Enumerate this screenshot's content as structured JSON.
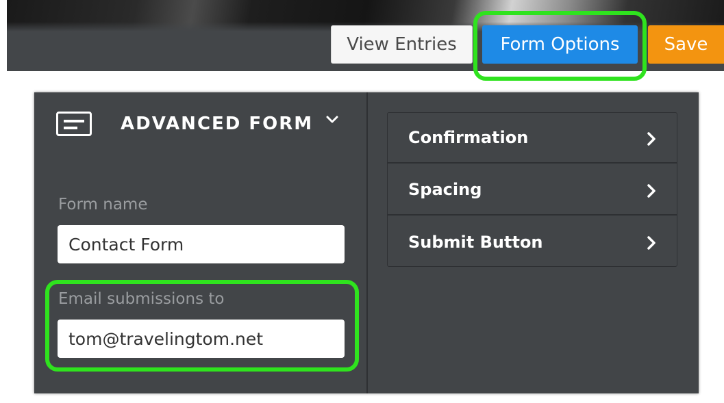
{
  "toolbar": {
    "view_entries_label": "View Entries",
    "form_options_label": "Form Options",
    "save_label": "Save"
  },
  "form_panel": {
    "title": "ADVANCED FORM",
    "icon": "form-icon",
    "fields": {
      "name": {
        "label": "Form name",
        "value": "Contact Form"
      },
      "email": {
        "label": "Email submissions to",
        "value": "tom@travelingtom.net"
      }
    }
  },
  "options": [
    {
      "label": "Confirmation",
      "icon": "chevron-right-icon"
    },
    {
      "label": "Spacing",
      "icon": "chevron-right-icon"
    },
    {
      "label": "Submit Button",
      "icon": "chevron-right-icon"
    }
  ],
  "colors": {
    "accent_blue": "#1e8ae6",
    "save_orange": "#f39410",
    "panel_bg": "#424548",
    "highlight_green": "#2fe31e"
  }
}
